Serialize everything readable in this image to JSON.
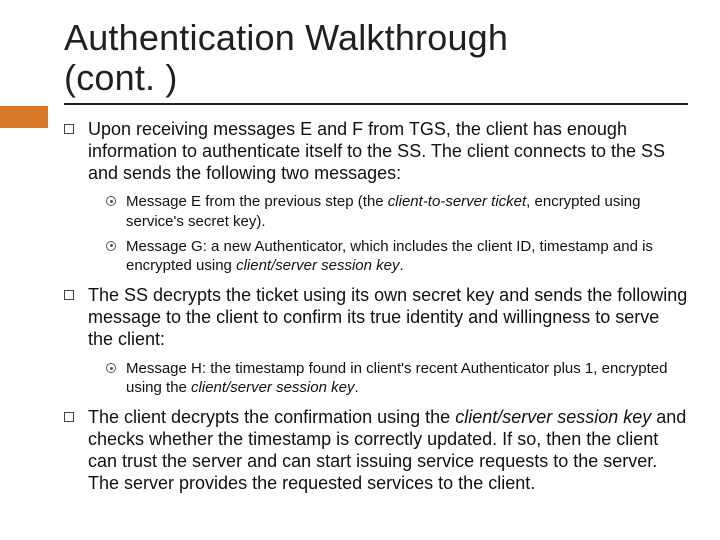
{
  "title_line1": "Authentication Walkthrough",
  "title_line2": "(cont. )",
  "bullets": [
    {
      "text": "Upon receiving messages E and F from TGS, the client has enough information to authenticate itself to the SS. The client connects to the SS and sends the following two messages:",
      "sub": [
        {
          "pre": "Message E from the previous step (the ",
          "em": "client-to-server ticket",
          "post": ", encrypted using service's secret key)."
        },
        {
          "pre": "Message G: a new Authenticator, which includes the client ID, timestamp and is encrypted using ",
          "em": "client/server session key",
          "post": "."
        }
      ]
    },
    {
      "text": "The SS decrypts the ticket using its own secret key and sends the following message to the client to confirm its true identity and willingness to serve the client:",
      "sub": [
        {
          "pre": "Message H: the timestamp found in client's recent Authenticator plus 1, encrypted using the ",
          "em": "client/server session key",
          "post": "."
        }
      ]
    },
    {
      "pre": "The client decrypts the confirmation using the ",
      "em": "client/server session key",
      "post": " and checks whether the timestamp is correctly updated. If so, then the client can trust the server and can start issuing service requests to the server. The server provides the requested services to the client."
    }
  ]
}
